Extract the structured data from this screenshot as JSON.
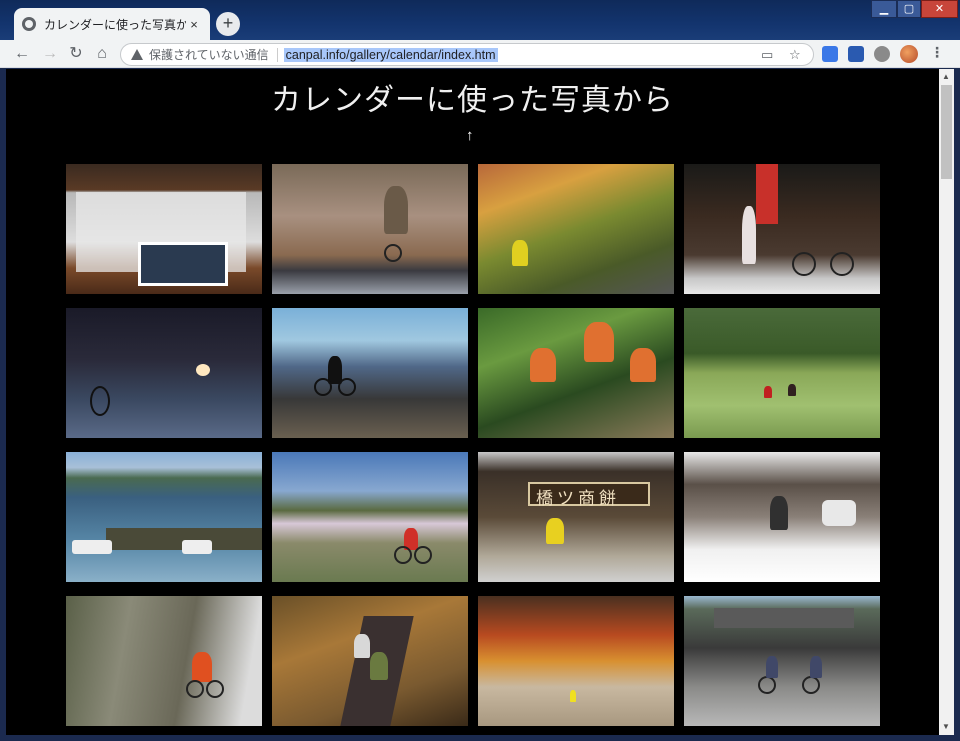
{
  "browser": {
    "tab_title": "カレンダーに使った写真から",
    "new_tab_label": "+",
    "tab_close": "×",
    "security_label": "保護されていない通信",
    "url": "canpal.info/gallery/calendar/index.htm",
    "window_controls": {
      "minimize": "▁",
      "maximize": "▢",
      "close": "✕"
    },
    "nav": {
      "back": "←",
      "forward": "→",
      "reload": "↻",
      "home": "⌂"
    },
    "menu_icon": "⋮"
  },
  "page": {
    "title": "カレンダーに使った写真から",
    "up_arrow": "↑"
  },
  "gallery": {
    "photos": [
      {
        "name": "calendar-display"
      },
      {
        "name": "cyclist-waving-bare-trees"
      },
      {
        "name": "cyclist-autumn-foliage"
      },
      {
        "name": "woman-bicycles-shopfront"
      },
      {
        "name": "bicycle-lantern-night-alley"
      },
      {
        "name": "cyclist-silhouette-sea"
      },
      {
        "name": "group-cyclists-orange-jerseys"
      },
      {
        "name": "cyclists-rice-fields"
      },
      {
        "name": "cyclist-on-harbor-pier"
      },
      {
        "name": "cyclist-cherry-blossom-valley"
      },
      {
        "name": "cyclist-rice-cake-shop"
      },
      {
        "name": "cyclist-snowy-village"
      },
      {
        "name": "cyclist-rock-cliff"
      },
      {
        "name": "cyclists-autumn-forest-path"
      },
      {
        "name": "autumn-tree-pampas-path"
      },
      {
        "name": "cyclists-old-townhouses"
      }
    ],
    "shop_sign_text": "橋ツ商餅"
  }
}
